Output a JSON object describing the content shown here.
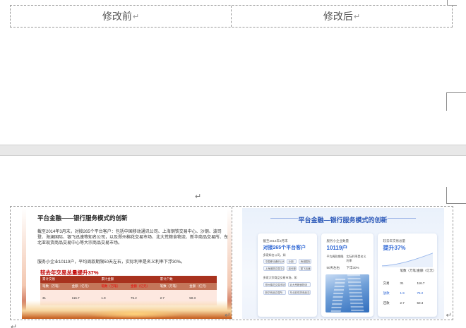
{
  "header_row": {
    "before_label": "修改前",
    "after_label": "修改后",
    "return_mark": "↵"
  },
  "marks": {
    "paragraph": "↵",
    "cell_end": "↵",
    "doc_end": "↵"
  },
  "before_slide": {
    "title": "平台金融——银行服务模式的创新",
    "para1": "截至2014年3月末，对接265个平台客户：包括中国移动通讯公司、上海钢铁交易中心、沙钢、波司登、海澜国际、银飞迅速等知名公司，以及郑州棉花交易市场、北大荒粮食物流、新华商品交易所、东北亚现货商品交易中心等大宗商品交易市场。",
    "para2": "服务小企业10119户，平均周款期限50天左右，实际利率是名义利率下浮30%。",
    "highlight": "较去年交易总量提升37%",
    "table_groups": [
      "累计交易",
      "累计金额",
      "累计户数"
    ],
    "table_headers": [
      "笔数（万笔）",
      "金额（亿元）",
      "笔数（万笔）",
      "金额（亿元）",
      "笔数（万笔）",
      "金额（亿元）"
    ],
    "table_values": [
      "31",
      "116.7",
      "1.9",
      "75.2",
      "2.7",
      "50.3"
    ]
  },
  "after_slide": {
    "title": "平台金融—银行服务模式的创新",
    "card1": {
      "caption": "截至2014年3月末",
      "big": "对接265个平台客户",
      "sec1": "多家知名公司，如",
      "pills1": [
        "中国移动通讯公司",
        "沙钢",
        "海澜国际",
        "上海钢铁交易中心",
        "波司登",
        "银飞迅速"
      ],
      "sec2": "多家大宗商品交易市场，如",
      "pills2": [
        "郑州棉花交易市场",
        "北大荒粮食物流",
        "新华商品交易所",
        "东北亚现货商品交易中心"
      ]
    },
    "card2": {
      "caption": "服务小企业数量",
      "big": "10119户",
      "col1_label": "平均周款期限",
      "col2_label": "实际利率是名义利率",
      "col1_value": "50天左右",
      "col2_value": "下浮30%"
    },
    "card3": {
      "caption": "较去年交易总量",
      "big": "提升37%",
      "col_headers": [
        "笔数（万笔）",
        "金额（亿元）"
      ],
      "rows": [
        {
          "label": "交易",
          "a": "31",
          "b": "116.7"
        },
        {
          "label": "放款",
          "a": "1.9",
          "b": "75.2"
        },
        {
          "label": "还款",
          "a": "2.7",
          "b": "50.3"
        }
      ]
    }
  }
}
